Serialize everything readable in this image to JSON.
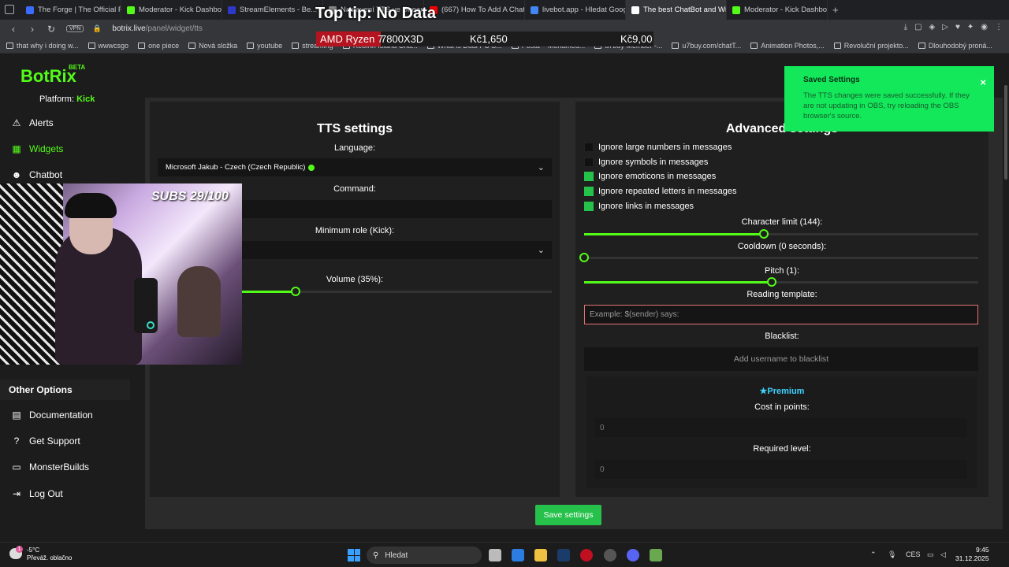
{
  "browser": {
    "tabs": [
      {
        "title": "The Forge | The Official Re",
        "fav": "#3b6cff"
      },
      {
        "title": "Moderator - Kick Dashboa",
        "fav": "#53fc18"
      },
      {
        "title": "StreamElements - Be...",
        "fav": "#2f39c9"
      },
      {
        "title": "Nastavení TTS ve Stream",
        "fav": "#888888"
      },
      {
        "title": "(667) How To Add A Chat",
        "fav": "#ff0000"
      },
      {
        "title": "livebot.app - Hledat Goog",
        "fav": "#4285f4"
      },
      {
        "title": "The best ChatBot and Wid",
        "fav": "#ffffff"
      },
      {
        "title": "Moderator - Kick Dashboa",
        "fav": "#53fc18"
      }
    ],
    "url_host": "botrix.live",
    "url_path": "/panel/widget/tts",
    "vpn": "VPN",
    "bookmarks": [
      "that why i doing w...",
      "wwwcsgo",
      "one piece",
      "Nová složka",
      "youtube",
      "streaming",
      "Rebirth Island Cha...",
      "What is Dual PC S...",
      "Pošta – Mohamed...",
      "u7buy Member -...",
      "u7buy.com/chatT...",
      "Animation Photos,...",
      "Revoluční projekto...",
      "Dlouhodobý proná..."
    ]
  },
  "overlay": {
    "top_tip": "Top tip: No Data",
    "cpu_name": "AMD Ryzen 7",
    "cpu_model": "7800X3D",
    "price1": "Kč1,650",
    "price2": "Kč9,00",
    "subs": "SUBS 29/100"
  },
  "sidebar": {
    "logo": "BotRix",
    "beta": "BETA",
    "platform_label": "Platform:",
    "platform": "Kick",
    "items": [
      {
        "label": "Alerts",
        "icon": "⚠"
      },
      {
        "label": "Widgets",
        "icon": "▦"
      },
      {
        "label": "Chatbot",
        "icon": "☻"
      }
    ],
    "other_heading": "Other Options",
    "other": [
      {
        "label": "Documentation",
        "icon": "▤"
      },
      {
        "label": "Get Support",
        "icon": "?"
      },
      {
        "label": "MonsterBuilds",
        "icon": "▭"
      },
      {
        "label": "Log Out",
        "icon": "⇥"
      }
    ]
  },
  "tts": {
    "title": "TTS settings",
    "language_label": "Language:",
    "language_value": "Microsoft Jakub - Czech (Czech Republic)",
    "command_label": "Command:",
    "min_role_label": "Minimum role (Kick):",
    "volume_label": "Volume (35%):",
    "volume": 0.35
  },
  "advanced": {
    "title": "Advanced settings",
    "options": [
      {
        "label": "Ignore large numbers in messages",
        "checked": false
      },
      {
        "label": "Ignore symbols in messages",
        "checked": false
      },
      {
        "label": "Ignore emoticons in messages",
        "checked": true
      },
      {
        "label": "Ignore repeated letters in messages",
        "checked": true
      },
      {
        "label": "Ignore links in messages",
        "checked": true
      }
    ],
    "char_limit_label": "Character limit (144):",
    "char_limit": 0.455,
    "cooldown_label": "Cooldown (0 seconds):",
    "cooldown": 0,
    "pitch_label": "Pitch (1):",
    "pitch": 0.475,
    "template_label": "Reading template:",
    "template_placeholder": "Example: $(sender) says:",
    "blacklist_label": "Blacklist:",
    "blacklist_button": "Add username to blacklist",
    "premium_title": "Premium",
    "cost_label": "Cost in points:",
    "cost_value": "0",
    "level_label": "Required level:",
    "level_value": "0"
  },
  "save_button": "Save settings",
  "toast": {
    "title": "Saved Settings",
    "message": "The TTS changes were saved successfully. If they are not updating in OBS, try reloading the OBS browser's source.",
    "close": "×"
  },
  "taskbar": {
    "temp": "-5°C",
    "weather": "Převáž. oblačno",
    "weather_badge": "1",
    "search": "Hledat",
    "lang": "CES",
    "time": "9:45",
    "date": "31.12.2025"
  }
}
